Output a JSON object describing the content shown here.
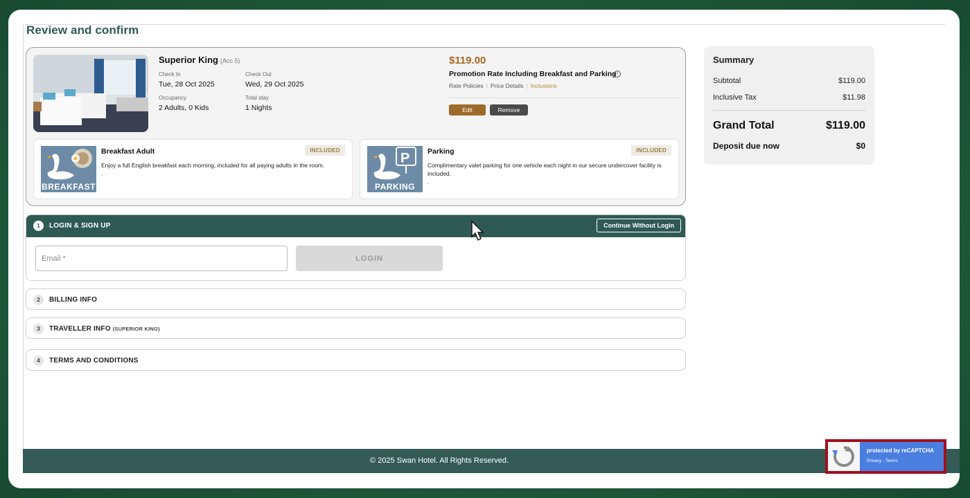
{
  "page": {
    "title": "Review and confirm"
  },
  "room": {
    "name": "Superior King",
    "acc": "(Acc 5)",
    "check_in_label": "Check In",
    "check_in": "Tue, 28 Oct 2025",
    "check_out_label": "Check Out",
    "check_out": "Wed, 29 Oct 2025",
    "occupancy_label": "Occupancy",
    "occupancy": "2 Adults, 0 Kids",
    "total_stay_label": "Total stay",
    "total_stay": "1 Nights",
    "price": "$119.00",
    "rate_name": "Promotion Rate Including Breakfast and Parking",
    "rate_links": [
      "Rate Policies",
      "Price Details",
      "Inclusions"
    ],
    "edit_label": "Edit",
    "remove_label": "Remove"
  },
  "inclusions": [
    {
      "title": "Breakfast Adult",
      "badge": "INCLUDED",
      "image_caption": "BREAKFAST",
      "description": "Enjoy a full English breakfast each morning, included for all paying adults in the room.",
      "extra": "."
    },
    {
      "title": "Parking",
      "badge": "INCLUDED",
      "image_caption": "PARKING",
      "description": "Complimentary valet parking for one vehicle each night in our secure undercover facility is included.",
      "extra": "."
    }
  ],
  "steps": {
    "login": {
      "number": "1",
      "title": "LOGIN & SIGN UP",
      "continue_label": "Continue Without Login",
      "email_placeholder": "Email *",
      "login_label": "LOGIN"
    },
    "billing": {
      "number": "2",
      "title": "BILLING INFO"
    },
    "traveller": {
      "number": "3",
      "title": "TRAVELLER INFO",
      "subtitle": "(SUPERIOR KING)"
    },
    "terms": {
      "number": "4",
      "title": "TERMS AND CONDITIONS"
    }
  },
  "summary": {
    "title": "Summary",
    "subtotal_label": "Subtotal",
    "subtotal": "$119.00",
    "tax_label": "Inclusive Tax",
    "tax": "$11.98",
    "grand_total_label": "Grand Total",
    "grand_total": "$119.00",
    "deposit_label": "Deposit due now",
    "deposit": "$0"
  },
  "footer": {
    "copyright": "© 2025 Swan Hotel. All Rights Reserved."
  },
  "recaptcha": {
    "protected": "protected by reCAPTCHA",
    "links": "Privacy - Terms"
  },
  "colors": {
    "brand_teal": "#2f5a54",
    "price_accent": "#a86a22",
    "edit_button": "#9d6a2a",
    "included_badge_text": "#a1773a",
    "captcha_highlight": "#a0101f"
  },
  "icons": [
    "info-icon",
    "swan-breakfast-icon",
    "swan-parking-icon",
    "recaptcha-logo-icon",
    "mouse-cursor-icon"
  ]
}
